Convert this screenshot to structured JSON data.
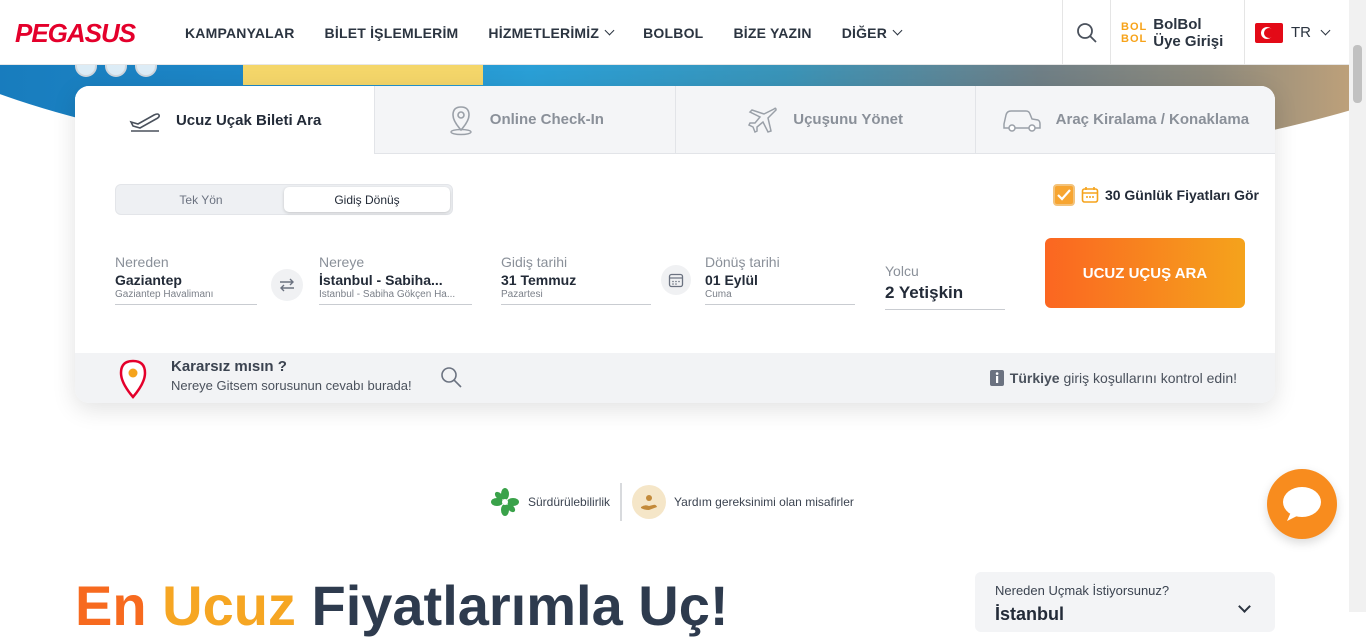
{
  "header": {
    "logo": "PEGASUS",
    "nav": [
      {
        "label": "KAMPANYALAR",
        "dropdown": false
      },
      {
        "label": "BİLET İŞLEMLERİM",
        "dropdown": false
      },
      {
        "label": "HİZMETLERİMİZ",
        "dropdown": true
      },
      {
        "label": "BOLBOL",
        "dropdown": false
      },
      {
        "label": "BİZE YAZIN",
        "dropdown": false
      },
      {
        "label": "DİĞER",
        "dropdown": true
      }
    ],
    "bolbol_logo_top": "BOL",
    "bolbol_logo_bottom": "BOL",
    "bolbol_line1": "BolBol",
    "bolbol_line2": "Üye Girişi",
    "language": "TR"
  },
  "tabs": [
    {
      "label": "Ucuz Uçak Bileti Ara",
      "icon": "plane-takeoff-icon",
      "active": true
    },
    {
      "label": "Online Check-In",
      "icon": "location-pin-icon",
      "active": false
    },
    {
      "label": "Uçuşunu Yönet",
      "icon": "plane-icon",
      "active": false
    },
    {
      "label": "Araç Kiralama / Konaklama",
      "icon": "car-icon",
      "active": false
    }
  ],
  "trip_type": {
    "one_way": "Tek Yön",
    "round_trip": "Gidiş Dönüş",
    "selected": "round_trip"
  },
  "price_calendar": {
    "label": "30 Günlük Fiyatları Gör",
    "checked": true
  },
  "search": {
    "from": {
      "label": "Nereden",
      "value": "Gaziantep",
      "sub": "Gaziantep Havalimanı"
    },
    "to": {
      "label": "Nereye",
      "value": "İstanbul - Sabiha...",
      "sub": "İstanbul - Sabiha Gökçen Ha..."
    },
    "depart": {
      "label": "Gidiş tarihi",
      "value": "31 Temmuz",
      "sub": "Pazartesi"
    },
    "return": {
      "label": "Dönüş tarihi",
      "value": "01 Eylül",
      "sub": "Cuma"
    },
    "passengers": {
      "label": "Yolcu",
      "value": "2 Yetişkin"
    },
    "button": "UCUZ UÇUŞ ARA"
  },
  "inspire": {
    "title": "Kararsız mısın ?",
    "subtitle": "Nereye Gitsem sorusunun cevabı burada!"
  },
  "entry_info": {
    "bold": "Türkiye",
    "text": "giriş koşullarını kontrol edin!"
  },
  "badges": [
    {
      "label": "Sürdürülebilirlik",
      "icon": "leaf-star-icon"
    },
    {
      "label": "Yardım gereksinimi olan misafirler",
      "icon": "helping-hand-icon"
    }
  ],
  "headline": {
    "part1": "En ",
    "part2": "Ucuz ",
    "part3": "Fiyatlarımla Uç!"
  },
  "from_card": {
    "label": "Nereden Uçmak İstiyorsunuz?",
    "value": "İstanbul"
  },
  "colors": {
    "brand_red": "#e4002b",
    "accent_orange": "#fb6621",
    "accent_yellow": "#f5a31c"
  }
}
